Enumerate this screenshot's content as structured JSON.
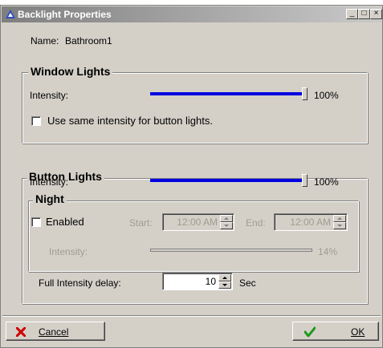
{
  "window": {
    "title": "Backlight Properties",
    "minimize": "_",
    "maximize": "□",
    "close": "×"
  },
  "name_row": {
    "label": "Name:",
    "value": "Bathroom1"
  },
  "window_lights": {
    "legend": "Window Lights",
    "intensity_label": "Intensity:",
    "intensity_value": "100%",
    "intensity_fraction": 1.0,
    "checkbox_label": "Use same intensity for button lights.",
    "checked": false
  },
  "button_lights": {
    "legend": "Button Lights",
    "intensity_label": "Intensity:",
    "intensity_value": "100%",
    "intensity_fraction": 1.0,
    "night": {
      "legend": "Night",
      "enabled_label": "Enabled",
      "enabled": false,
      "start_label": "Start:",
      "start_value": "12:00 AM",
      "end_label": "End:",
      "end_value": "12:00 AM",
      "intensity_label": "Intensity:",
      "intensity_value": "14%",
      "intensity_fraction": 0.14
    },
    "delay_label": "Full Intensity delay:",
    "delay_value": "10",
    "delay_unit": "Sec"
  },
  "buttons": {
    "cancel": "Cancel",
    "ok": "OK"
  },
  "colors": {
    "slider": "#0000e0",
    "cancel_icon": "#d00000",
    "ok_icon": "#1a9a1a"
  }
}
